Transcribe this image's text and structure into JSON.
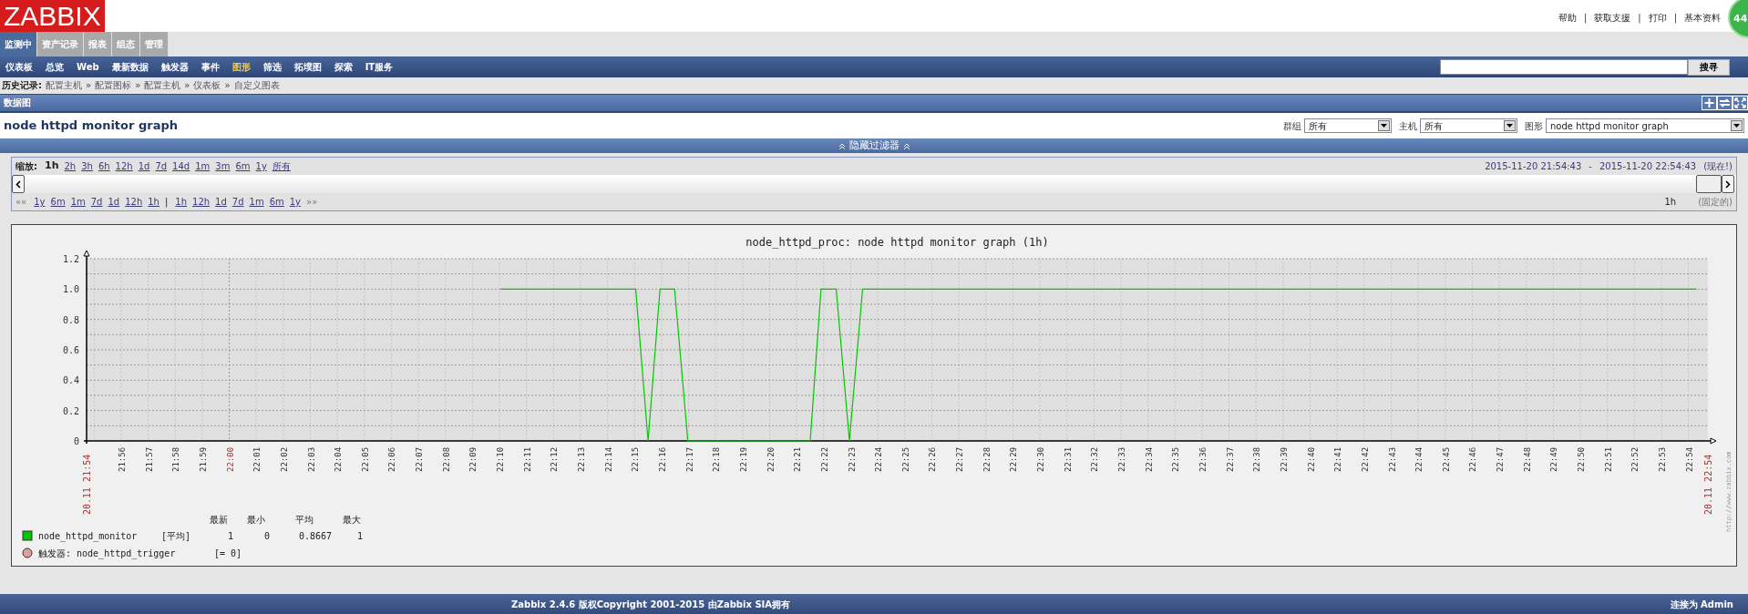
{
  "logo": "ZABBIX",
  "header_links": [
    "帮助",
    "获取支援",
    "打印",
    "基本资料"
  ],
  "header_separator": "|",
  "speed_ball": {
    "text": "44"
  },
  "main_tabs": [
    {
      "label": "监测中",
      "selected": true
    },
    {
      "label": "资产记录",
      "selected": false
    },
    {
      "label": "报表",
      "selected": false
    },
    {
      "label": "组态",
      "selected": false
    },
    {
      "label": "管理",
      "selected": false
    }
  ],
  "nav": [
    {
      "label": "仪表板",
      "selected": false
    },
    {
      "label": "总览",
      "selected": false
    },
    {
      "label": "Web",
      "selected": false
    },
    {
      "label": "最新数据",
      "selected": false
    },
    {
      "label": "触发器",
      "selected": false
    },
    {
      "label": "事件",
      "selected": false
    },
    {
      "label": "图形",
      "selected": true
    },
    {
      "label": "筛选",
      "selected": false
    },
    {
      "label": "拓墣图",
      "selected": false
    },
    {
      "label": "探索",
      "selected": false
    },
    {
      "label": "IT服务",
      "selected": false
    }
  ],
  "search": {
    "button": "搜寻"
  },
  "breadcrumb": {
    "label": "历史记录:",
    "separator": "»",
    "items": [
      "配置主机",
      "配置图标",
      "配置主机",
      "仪表板",
      "自定义图表"
    ]
  },
  "section": {
    "title": "数据图"
  },
  "page_title": "node httpd monitor graph",
  "filters": [
    {
      "label": "群组",
      "value": "所有"
    },
    {
      "label": "主机",
      "value": "所有"
    },
    {
      "label": "图形",
      "value": "node httpd monitor graph"
    }
  ],
  "filter_toggle": "隐藏过滤器",
  "zoom": {
    "label": "缩放:",
    "options": [
      {
        "label": "1h",
        "selected": true
      },
      {
        "label": "2h",
        "selected": false
      },
      {
        "label": "3h",
        "selected": false
      },
      {
        "label": "6h",
        "selected": false
      },
      {
        "label": "12h",
        "selected": false
      },
      {
        "label": "1d",
        "selected": false
      },
      {
        "label": "7d",
        "selected": false
      },
      {
        "label": "14d",
        "selected": false
      },
      {
        "label": "1m",
        "selected": false
      },
      {
        "label": "3m",
        "selected": false
      },
      {
        "label": "6m",
        "selected": false
      },
      {
        "label": "1y",
        "selected": false
      },
      {
        "label": "所有",
        "selected": false
      }
    ],
    "period_from": "2015-11-20 21:54:43",
    "period_separator": "-",
    "period_to": "2015-11-20 22:54:43",
    "now_link": "(现在!)",
    "back_start": "««",
    "back_links": [
      "1y",
      "6m",
      "1m",
      "7d",
      "1d",
      "12h",
      "1h"
    ],
    "divider": "|",
    "forward_links": [
      "1h",
      "12h",
      "1d",
      "7d",
      "1m",
      "6m",
      "1y"
    ],
    "forward_end": "»»",
    "period": "1h",
    "fixed": "(固定的)"
  },
  "graph": {
    "title": "node_httpd_proc: node httpd monitor graph (1h)",
    "start_label": "20.11 21:54",
    "end_label": "20.11 22:54",
    "url": "http://www.zabbix.com",
    "chart_data": {
      "type": "line",
      "grid": true,
      "xlim": [
        1314.72,
        1374.72
      ],
      "ylim": [
        0,
        1.2
      ],
      "yticks": [
        {
          "value": 0,
          "label": "0"
        },
        {
          "value": 0.2,
          "label": "0.2"
        },
        {
          "value": 0.4,
          "label": "0.4"
        },
        {
          "value": 0.6,
          "label": "0.6"
        },
        {
          "value": 0.8,
          "label": "0.8"
        },
        {
          "value": 1,
          "label": "1.0"
        },
        {
          "value": 1.2,
          "label": "1.2"
        }
      ],
      "xticks": [
        {
          "value": 1316,
          "label": "21:56"
        },
        {
          "value": 1317,
          "label": "21:57"
        },
        {
          "value": 1318,
          "label": "21:58"
        },
        {
          "value": 1319,
          "label": "21:59"
        },
        {
          "value": 1320,
          "label": "22:00"
        },
        {
          "value": 1321,
          "label": "22:01"
        },
        {
          "value": 1322,
          "label": "22:02"
        },
        {
          "value": 1323,
          "label": "22:03"
        },
        {
          "value": 1324,
          "label": "22:04"
        },
        {
          "value": 1325,
          "label": "22:05"
        },
        {
          "value": 1326,
          "label": "22:06"
        },
        {
          "value": 1327,
          "label": "22:07"
        },
        {
          "value": 1328,
          "label": "22:08"
        },
        {
          "value": 1329,
          "label": "22:09"
        },
        {
          "value": 1330,
          "label": "22:10"
        },
        {
          "value": 1331,
          "label": "22:11"
        },
        {
          "value": 1332,
          "label": "22:12"
        },
        {
          "value": 1333,
          "label": "22:13"
        },
        {
          "value": 1334,
          "label": "22:14"
        },
        {
          "value": 1335,
          "label": "22:15"
        },
        {
          "value": 1336,
          "label": "22:16"
        },
        {
          "value": 1337,
          "label": "22:17"
        },
        {
          "value": 1338,
          "label": "22:18"
        },
        {
          "value": 1339,
          "label": "22:19"
        },
        {
          "value": 1340,
          "label": "22:20"
        },
        {
          "value": 1341,
          "label": "22:21"
        },
        {
          "value": 1342,
          "label": "22:22"
        },
        {
          "value": 1343,
          "label": "22:23"
        },
        {
          "value": 1344,
          "label": "22:24"
        },
        {
          "value": 1345,
          "label": "22:25"
        },
        {
          "value": 1346,
          "label": "22:26"
        },
        {
          "value": 1347,
          "label": "22:27"
        },
        {
          "value": 1348,
          "label": "22:28"
        },
        {
          "value": 1349,
          "label": "22:29"
        },
        {
          "value": 1350,
          "label": "22:30"
        },
        {
          "value": 1351,
          "label": "22:31"
        },
        {
          "value": 1352,
          "label": "22:32"
        },
        {
          "value": 1353,
          "label": "22:33"
        },
        {
          "value": 1354,
          "label": "22:34"
        },
        {
          "value": 1355,
          "label": "22:35"
        },
        {
          "value": 1356,
          "label": "22:36"
        },
        {
          "value": 1357,
          "label": "22:37"
        },
        {
          "value": 1358,
          "label": "22:38"
        },
        {
          "value": 1359,
          "label": "22:39"
        },
        {
          "value": 1360,
          "label": "22:40"
        },
        {
          "value": 1361,
          "label": "22:41"
        },
        {
          "value": 1362,
          "label": "22:42"
        },
        {
          "value": 1363,
          "label": "22:43"
        },
        {
          "value": 1364,
          "label": "22:44"
        },
        {
          "value": 1365,
          "label": "22:45"
        },
        {
          "value": 1366,
          "label": "22:46"
        },
        {
          "value": 1367,
          "label": "22:47"
        },
        {
          "value": 1368,
          "label": "22:48"
        },
        {
          "value": 1369,
          "label": "22:49"
        },
        {
          "value": 1370,
          "label": "22:50"
        },
        {
          "value": 1371,
          "label": "22:51"
        },
        {
          "value": 1372,
          "label": "22:52"
        },
        {
          "value": 1373,
          "label": "22:53"
        },
        {
          "value": 1374,
          "label": "22:54"
        }
      ],
      "x": [
        1330.04,
        1335.04,
        1335.5,
        1335.94,
        1336.48,
        1336.97,
        1341.5,
        1341.9,
        1342.46,
        1342.95,
        1343.44,
        1374.3
      ],
      "series": [
        {
          "name": "node_httpd_monitor",
          "color": "#00c800",
          "values": [
            1,
            1,
            0,
            1,
            1,
            0,
            0,
            1,
            1,
            0,
            1,
            1
          ]
        }
      ]
    },
    "legend": {
      "columns": [
        "最新",
        "最小",
        "平均",
        "最大"
      ],
      "items": [
        {
          "kind": "series",
          "color": "#00c800",
          "function": "[平均]",
          "values": [
            "1",
            "0",
            "0.8667",
            "1"
          ]
        },
        {
          "kind": "trigger",
          "color": "#e0a0a0",
          "name": "触发器: node_httpd_trigger",
          "condition": "[= 0]"
        }
      ]
    }
  },
  "footer": {
    "copyright": "Zabbix 2.4.6 版权Copyright 2001-2015 由Zabbix SIA拥有",
    "user": "连接为 Admin"
  }
}
